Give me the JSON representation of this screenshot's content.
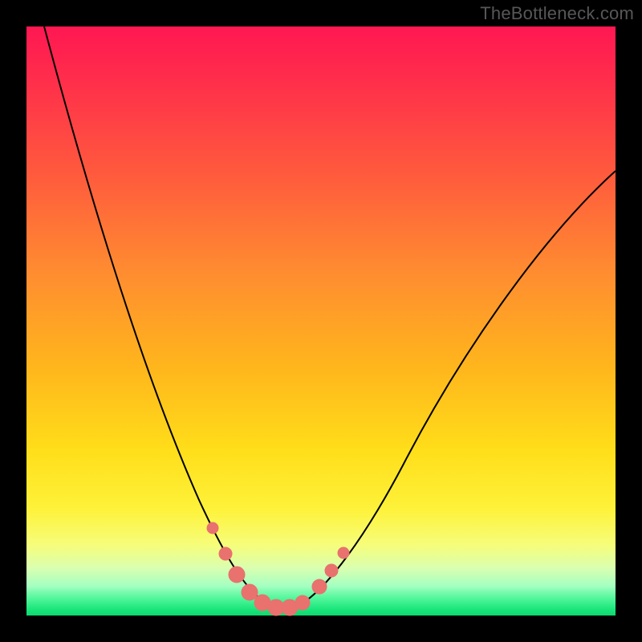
{
  "watermark": "TheBottleneck.com",
  "colors": {
    "background": "#000000",
    "curve": "#000000",
    "dots": "#e9716e"
  },
  "chart_data": {
    "type": "line",
    "title": "",
    "xlabel": "",
    "ylabel": "",
    "xlim": [
      0,
      100
    ],
    "ylim": [
      0,
      100
    ],
    "x": [
      3,
      6,
      9,
      12,
      15,
      18,
      21,
      24,
      27,
      30,
      32,
      34,
      36,
      38,
      40,
      42,
      45,
      48,
      52,
      56,
      60,
      65,
      70,
      75,
      80,
      85,
      90,
      95,
      100
    ],
    "y": [
      100,
      90,
      80,
      70,
      60,
      51,
      42,
      34,
      26,
      19,
      14,
      10,
      6,
      3,
      1.5,
      1,
      1.5,
      3,
      6,
      10,
      15,
      21,
      28,
      35,
      42,
      49,
      56,
      62,
      68
    ],
    "series": [
      {
        "name": "bottleneck-curve",
        "description": "V-shaped curve with minimum near x≈42"
      }
    ],
    "markers": {
      "x": [
        30,
        32,
        34,
        36,
        38,
        40,
        42,
        44,
        46,
        48,
        50
      ],
      "y": [
        15,
        10,
        6,
        3,
        2,
        1.5,
        1.5,
        2,
        4,
        7,
        11
      ],
      "radius": [
        7,
        8,
        10,
        10,
        10,
        10,
        10,
        9,
        9,
        8,
        7
      ]
    }
  }
}
